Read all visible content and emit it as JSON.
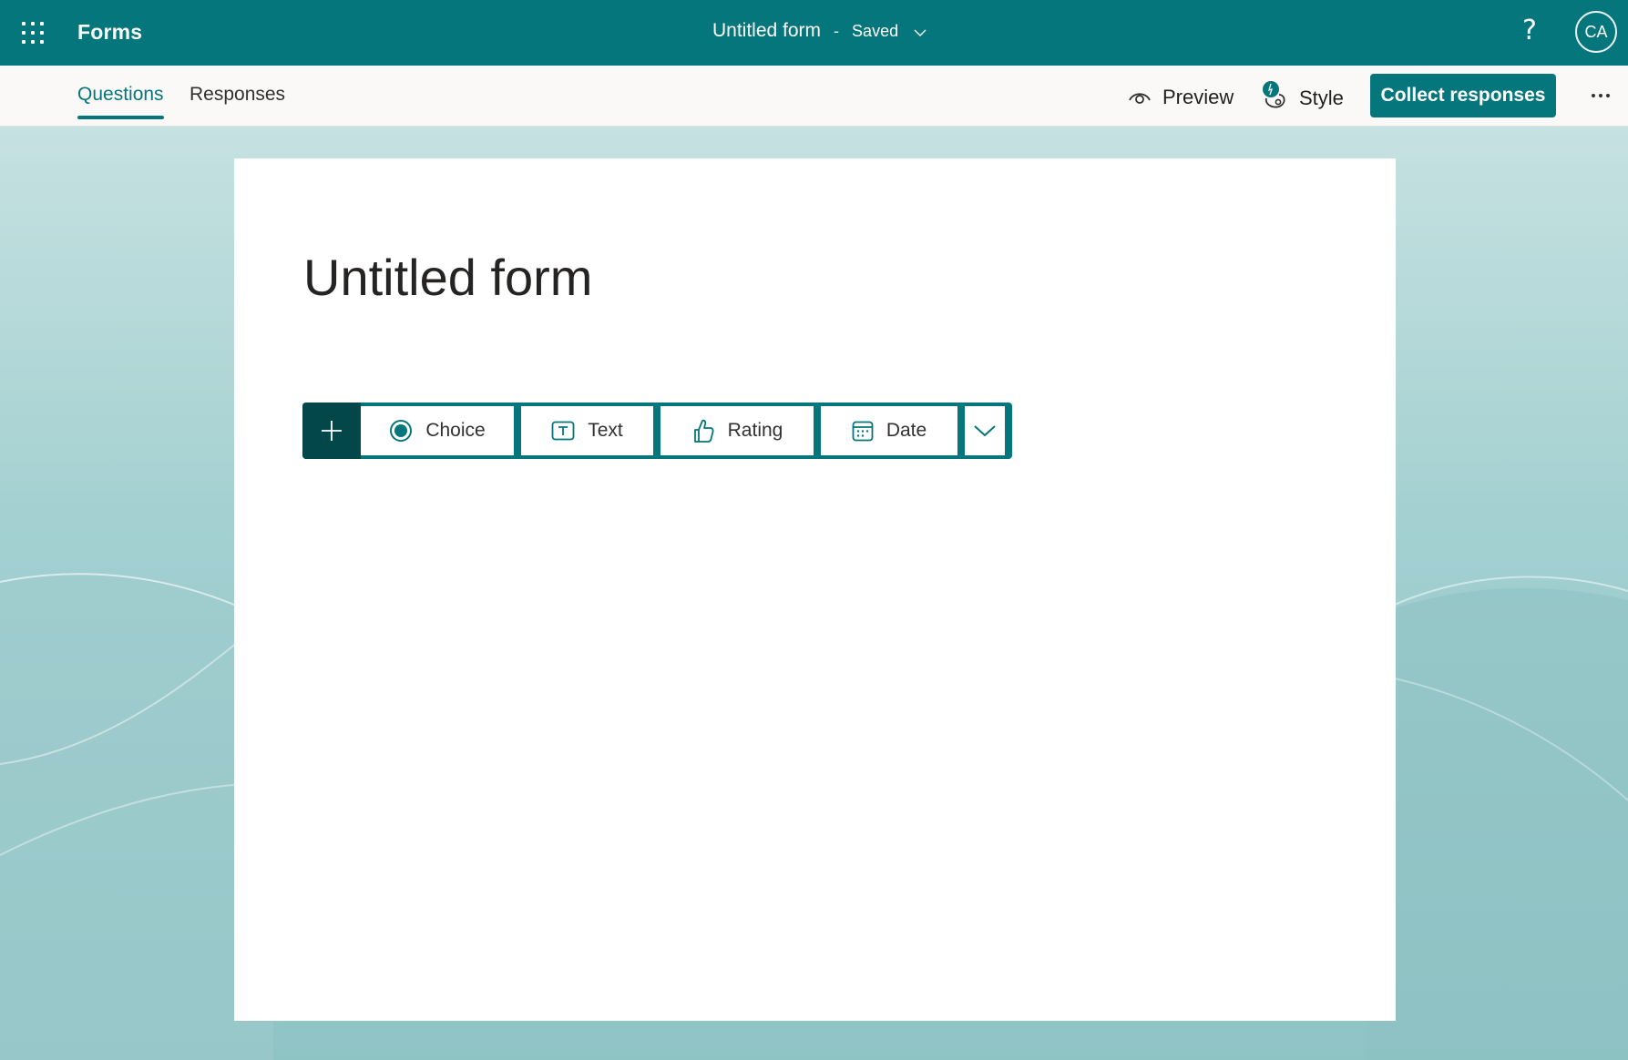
{
  "app": {
    "name": "Forms",
    "doc_title": "Untitled form",
    "doc_separator": "-",
    "save_status": "Saved",
    "help_label": "?",
    "user_initials": "CA"
  },
  "tabs": [
    {
      "label": "Questions",
      "active": true
    },
    {
      "label": "Responses",
      "active": false
    }
  ],
  "actions": {
    "preview_label": "Preview",
    "style_label": "Style",
    "collect_label": "Collect responses"
  },
  "form": {
    "title": "Untitled form"
  },
  "question_types": [
    {
      "label": "Choice",
      "icon": "radio-icon"
    },
    {
      "label": "Text",
      "icon": "text-box-icon"
    },
    {
      "label": "Rating",
      "icon": "thumb-up-icon"
    },
    {
      "label": "Date",
      "icon": "calendar-icon"
    }
  ],
  "colors": {
    "brand": "#05767c",
    "brand_dark": "#03474b",
    "background_gradient_top": "#c6e1e1",
    "background_gradient_bottom": "#8fc4c5"
  }
}
